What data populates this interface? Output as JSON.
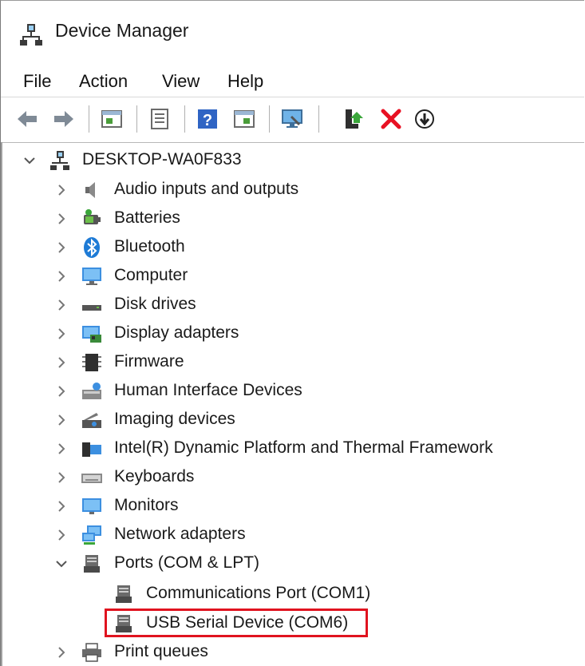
{
  "window": {
    "title": "Device Manager"
  },
  "menu": [
    "File",
    "Action",
    "View",
    "Help"
  ],
  "toolbar": {
    "buttons": [
      "back-icon",
      "forward-icon",
      "properties-icon",
      "show-hide-icon",
      "help-icon",
      "view-icon",
      "scan-hardware-icon",
      "update-driver-icon",
      "uninstall-icon",
      "disable-device-icon"
    ]
  },
  "tree": {
    "root": "DESKTOP-WA0F833",
    "categories": [
      "Audio inputs and outputs",
      "Batteries",
      "Bluetooth",
      "Computer",
      "Disk drives",
      "Display adapters",
      "Firmware",
      "Human Interface Devices",
      "Imaging devices",
      "Intel(R) Dynamic Platform and Thermal Framework",
      "Keyboards",
      "Monitors",
      "Network adapters",
      "Ports (COM & LPT)",
      "Print queues"
    ],
    "ports_children": [
      "Communications Port (COM1)",
      "USB Serial Device (COM6)"
    ],
    "highlighted_item": "USB Serial Device (COM6)"
  },
  "colors": {
    "highlight": "#e0131f",
    "uninstall": "#e81123",
    "accent": "#1e7bd6"
  }
}
